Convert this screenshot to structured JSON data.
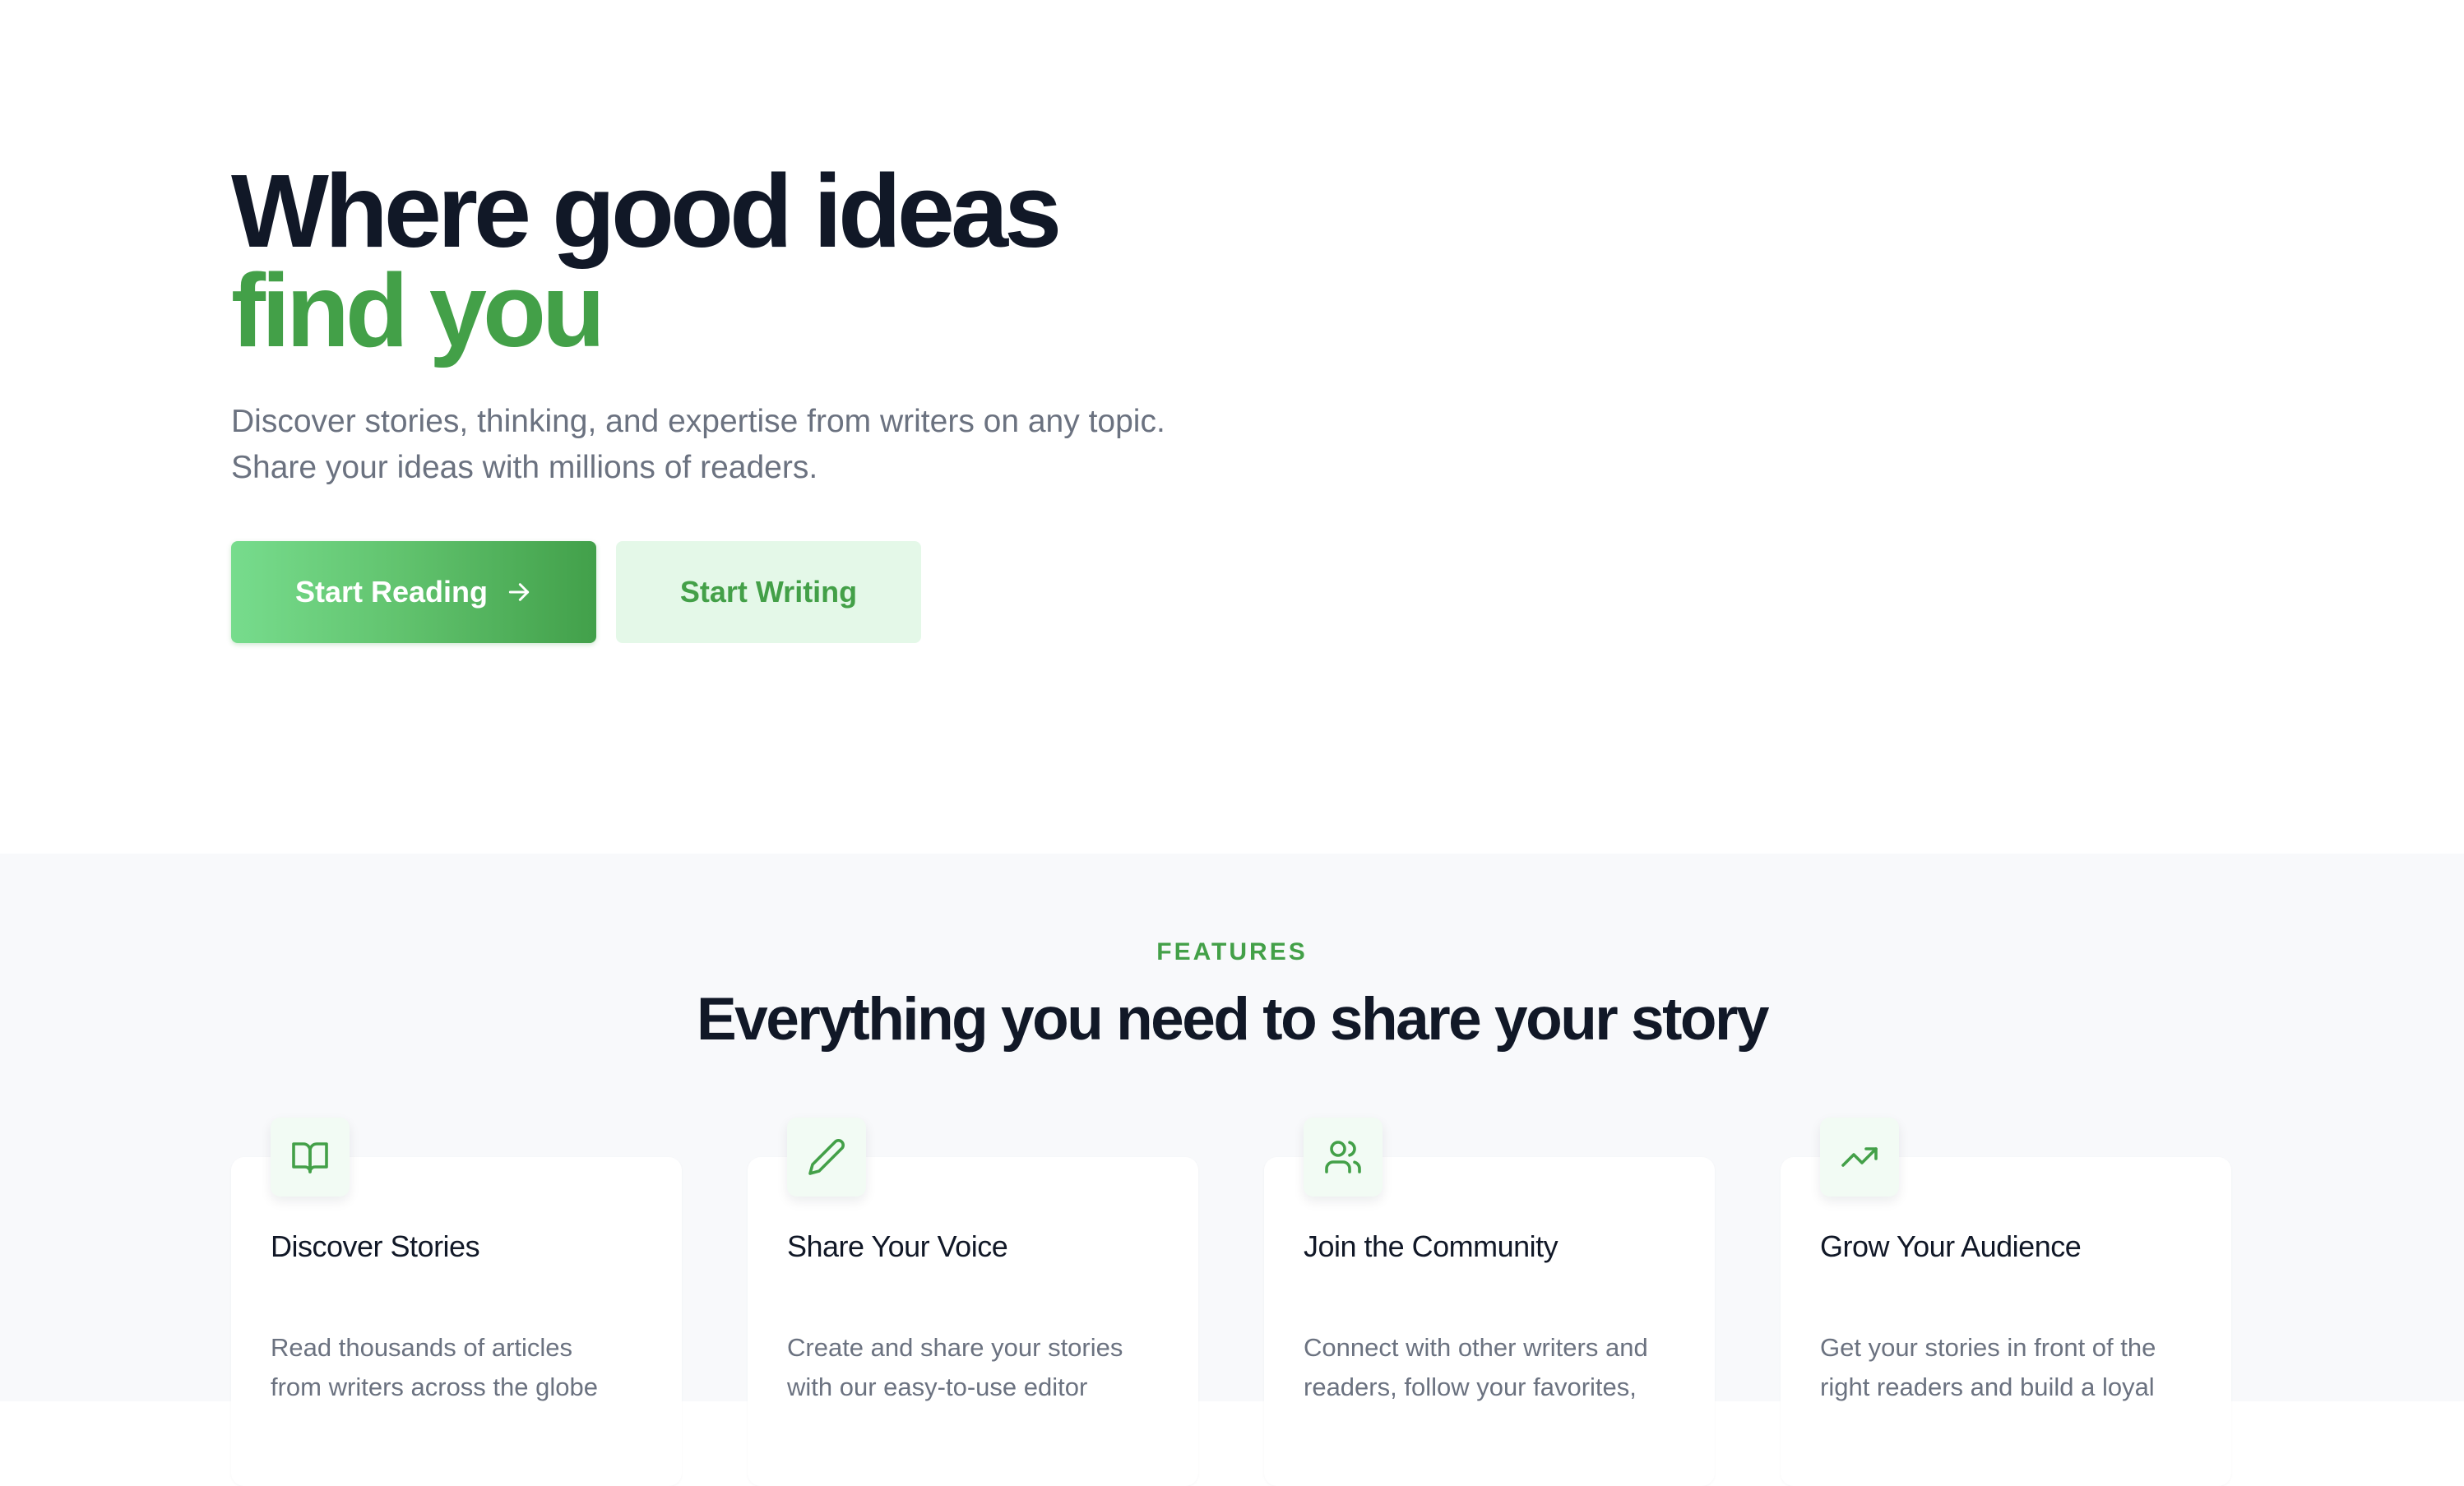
{
  "hero": {
    "title_line1": "Where good ideas",
    "title_line2": "find you",
    "subtitle_line1": "Discover stories, thinking, and expertise from writers on any topic.",
    "subtitle_line2": "Share your ideas with millions of readers.",
    "primary_button": "Start Reading",
    "secondary_button": "Start Writing"
  },
  "features": {
    "eyebrow": "FEATURES",
    "title": "Everything you need to share your story",
    "cards": [
      {
        "icon": "book-open-icon",
        "title": "Discover Stories",
        "description": "Read thousands of articles from writers across the globe"
      },
      {
        "icon": "pencil-icon",
        "title": "Share Your Voice",
        "description": "Create and share your stories with our easy-to-use editor"
      },
      {
        "icon": "users-icon",
        "title": "Join the Community",
        "description": "Connect with other writers and readers, follow your favorites,"
      },
      {
        "icon": "trending-up-icon",
        "title": "Grow Your Audience",
        "description": "Get your stories in front of the right readers and build a loyal"
      }
    ]
  },
  "colors": {
    "accent": "#43a048",
    "heading": "#111827",
    "body_text": "#6b7280",
    "section_bg": "#f8f9fb"
  }
}
